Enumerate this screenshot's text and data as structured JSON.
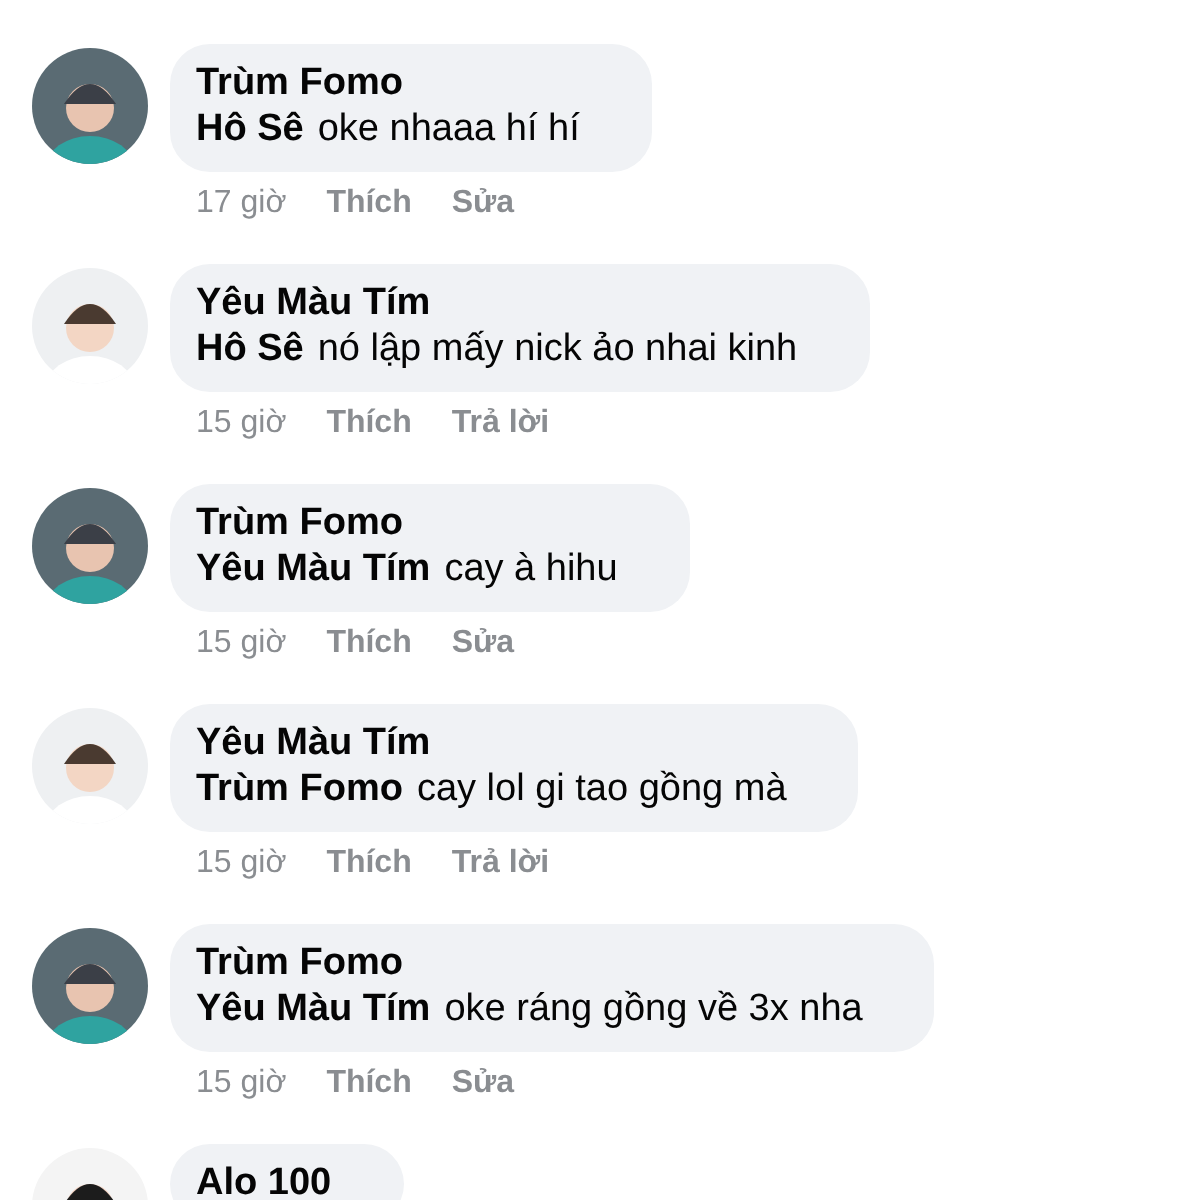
{
  "comments": [
    {
      "kind": "helmet",
      "author": "Trùm Fomo",
      "mention": "Hô Sê",
      "text": "oke nhaaa hí hí",
      "time": "17 giờ",
      "like": "Thích",
      "action": "Sửa"
    },
    {
      "kind": "baby",
      "author": "Yêu Màu Tím",
      "mention": "Hô Sê",
      "text": "nó lập mấy nick ảo nhai kinh",
      "time": "15 giờ",
      "like": "Thích",
      "action": "Trả lời"
    },
    {
      "kind": "helmet",
      "author": "Trùm Fomo",
      "mention": "Yêu Màu Tím",
      "text": "cay à hihu",
      "time": "15 giờ",
      "like": "Thích",
      "action": "Sửa"
    },
    {
      "kind": "baby",
      "author": "Yêu Màu Tím",
      "mention": "Trùm Fomo",
      "text": "cay lol gi tao gồng mà",
      "time": "15 giờ",
      "like": "Thích",
      "action": "Trả lời"
    },
    {
      "kind": "helmet",
      "author": "Trùm Fomo",
      "mention": "Yêu Màu Tím",
      "text": "oke ráng gồng về 3x nha",
      "time": "15 giờ",
      "like": "Thích",
      "action": "Sửa"
    },
    {
      "kind": "hair",
      "author": "Alo 100"
    }
  ]
}
